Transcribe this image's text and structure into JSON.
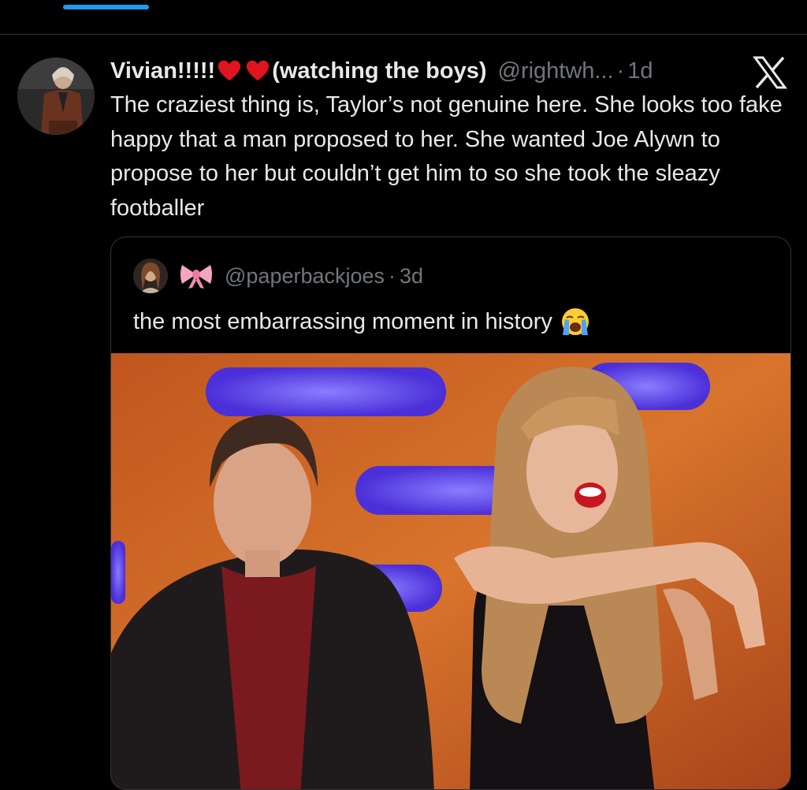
{
  "tabs": {
    "active_indicator_color": "#1d9bf0"
  },
  "tweet": {
    "display_name_part1": "Vivian!!!!!",
    "display_name_part2": "(watching the boys)",
    "heart_icons": [
      "red-heart-icon",
      "red-heart-icon"
    ],
    "handle": "@rightwh...",
    "dot": "·",
    "age": "1d",
    "platform_icon": "x-logo-icon",
    "text": "The craziest thing is, Taylor’s not genuine here. She looks too fake happy that a man proposed to her. She wanted Joe Alywn to propose to her but couldn’t get him to so she took the sleazy footballer"
  },
  "quote": {
    "badge_icon": "pink-ribbon-bow-icon",
    "handle": "@paperbackjoes",
    "dot": "·",
    "age": "3d",
    "text": "the most embarrassing moment in history",
    "emoji_icon": "loudly-crying-face-icon"
  },
  "colors": {
    "background": "#000000",
    "text": "#e7e9ea",
    "muted": "#71767b",
    "border": "#2f3336",
    "heart": "#e0141e"
  }
}
